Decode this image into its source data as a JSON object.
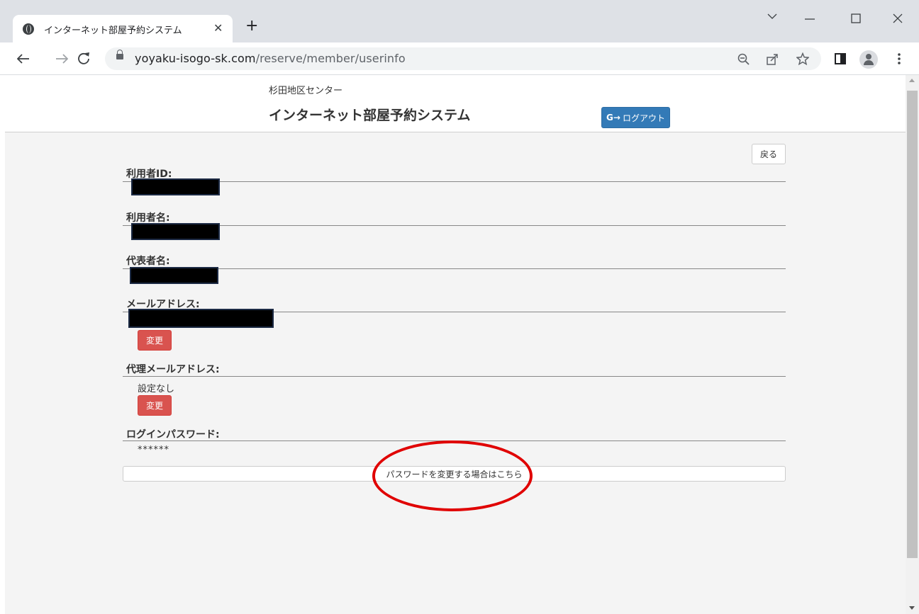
{
  "browser": {
    "tab_title": "インターネット部屋予約システム",
    "tab_close": "✕",
    "new_tab": "+",
    "url_host": "yoyaku-isogo-sk.com",
    "url_path": "/reserve/member/userinfo",
    "icons": [
      "globe-icon",
      "back-arrow-icon",
      "forward-arrow-icon",
      "reload-icon",
      "lock-icon",
      "zoom-out-icon",
      "share-icon",
      "star-icon",
      "side-panel-icon",
      "profile-icon",
      "menu-icon",
      "chevron-down-icon",
      "minimize-icon",
      "maximize-icon",
      "close-icon"
    ]
  },
  "header": {
    "center_name": "杉田地区センター",
    "system_title": "インターネット部屋予約システム",
    "logout_label": "ログアウト",
    "logout_color": "#337ab7"
  },
  "main": {
    "back_label": "戻る",
    "user_id_label": "利用者ID:",
    "user_name_label": "利用者名:",
    "rep_name_label": "代表者名:",
    "email_label": "メールアドレス:",
    "email_change_label": "変更",
    "proxy_email_label": "代理メールアドレス:",
    "proxy_email_value": "設定なし",
    "proxy_change_label": "変更",
    "password_label": "ログインパスワード:",
    "password_value": "******",
    "password_change_link": "パスワードを変更する場合はこちら",
    "danger_color": "#d9534f",
    "annotation_color": "#e00000"
  }
}
